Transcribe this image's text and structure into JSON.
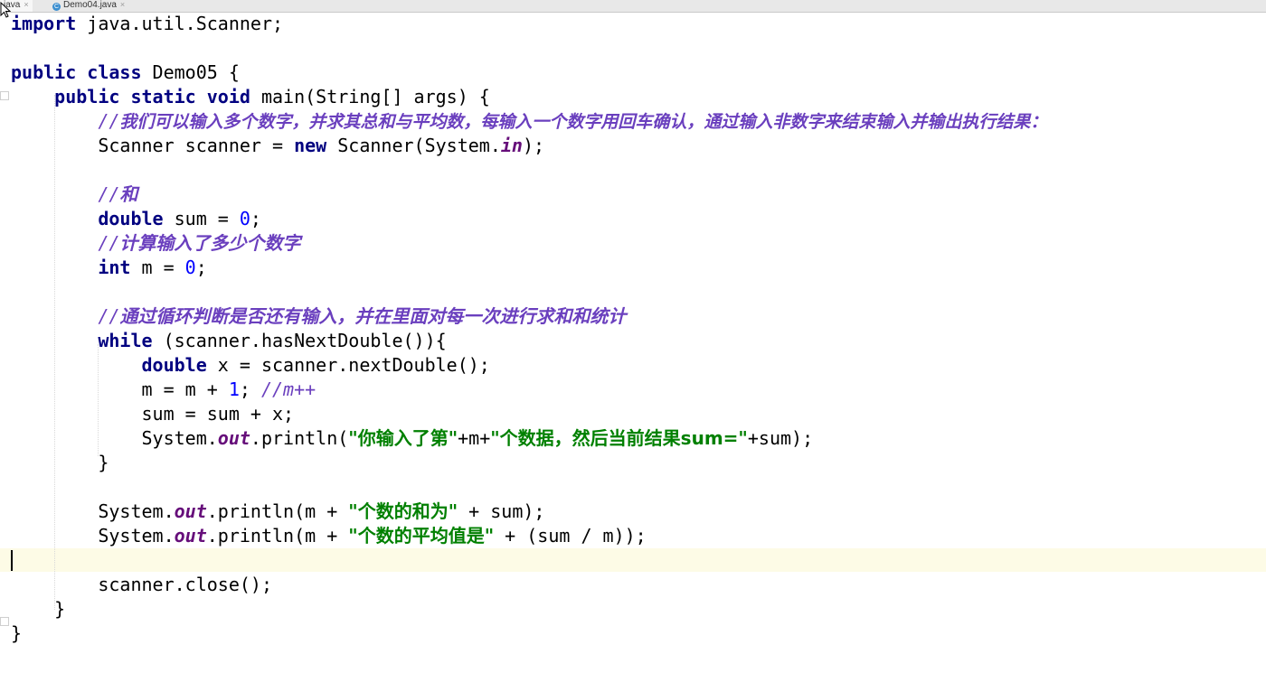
{
  "tabs": [
    {
      "label": "java",
      "active": true
    },
    {
      "label": "Demo04.java",
      "active": false
    }
  ],
  "code": {
    "l1": {
      "kw": "import",
      "rest": " java.util.Scanner;"
    },
    "l3": {
      "kw1": "public",
      "kw2": "class",
      "rest": " Demo05 {"
    },
    "l4": {
      "indent": "    ",
      "kw1": "public",
      "kw2": "static",
      "kw3": "void",
      "rest": " main(String[] args) {"
    },
    "l5": {
      "indent": "        ",
      "slashes": "//",
      "comment": "我们可以输入多个数字，并求其总和与平均数，每输入一个数字用回车确认，通过输入非数字来结束输入并输出执行结果："
    },
    "l6": {
      "indent": "        ",
      "a": "Scanner scanner = ",
      "kw": "new",
      "b": " Scanner(System.",
      "fld": "in",
      "c": ");"
    },
    "l8": {
      "indent": "        ",
      "slashes": "//",
      "comment": "和"
    },
    "l9": {
      "indent": "        ",
      "kw": "double",
      "a": " sum = ",
      "num": "0",
      "b": ";"
    },
    "l10": {
      "indent": "        ",
      "slashes": "//",
      "comment": "计算输入了多少个数字"
    },
    "l11": {
      "indent": "        ",
      "kw": "int",
      "a": " m = ",
      "num": "0",
      "b": ";"
    },
    "l13": {
      "indent": "        ",
      "slashes": "//",
      "comment": "通过循环判断是否还有输入，并在里面对每一次进行求和和统计"
    },
    "l14": {
      "indent": "        ",
      "kw": "while",
      "rest": " (scanner.hasNextDouble()){"
    },
    "l15": {
      "indent": "            ",
      "kw": "double",
      "rest": " x = scanner.nextDouble();"
    },
    "l16": {
      "indent": "            ",
      "a": "m = m + ",
      "num": "1",
      "b": "; ",
      "comment": "//m++"
    },
    "l17": {
      "indent": "            ",
      "text": "sum = sum + x;"
    },
    "l18": {
      "indent": "            ",
      "a": "System.",
      "fld": "out",
      "b": ".println(",
      "s1": "\"你输入了第\"",
      "c": "+m+",
      "s2": "\"个数据，然后当前结果sum=\"",
      "d": "+sum);"
    },
    "l19": {
      "indent": "        ",
      "text": "}"
    },
    "l21": {
      "indent": "        ",
      "a": "System.",
      "fld": "out",
      "b": ".println(m + ",
      "s": "\"个数的和为\"",
      "c": " + sum);"
    },
    "l22": {
      "indent": "        ",
      "a": "System.",
      "fld": "out",
      "b": ".println(m + ",
      "s": "\"个数的平均值是\"",
      "c": " + (sum / m));"
    },
    "l24": {
      "indent": "        ",
      "text": "scanner.close();"
    },
    "l25": {
      "indent": "    ",
      "text": "}"
    },
    "l26": {
      "text": "}"
    }
  },
  "colors": {
    "keyword": "#000080",
    "comment": "#6a3fbe",
    "number": "#0000ff",
    "string": "#008000",
    "field": "#660e7a",
    "current_line": "#fdfbe6"
  }
}
